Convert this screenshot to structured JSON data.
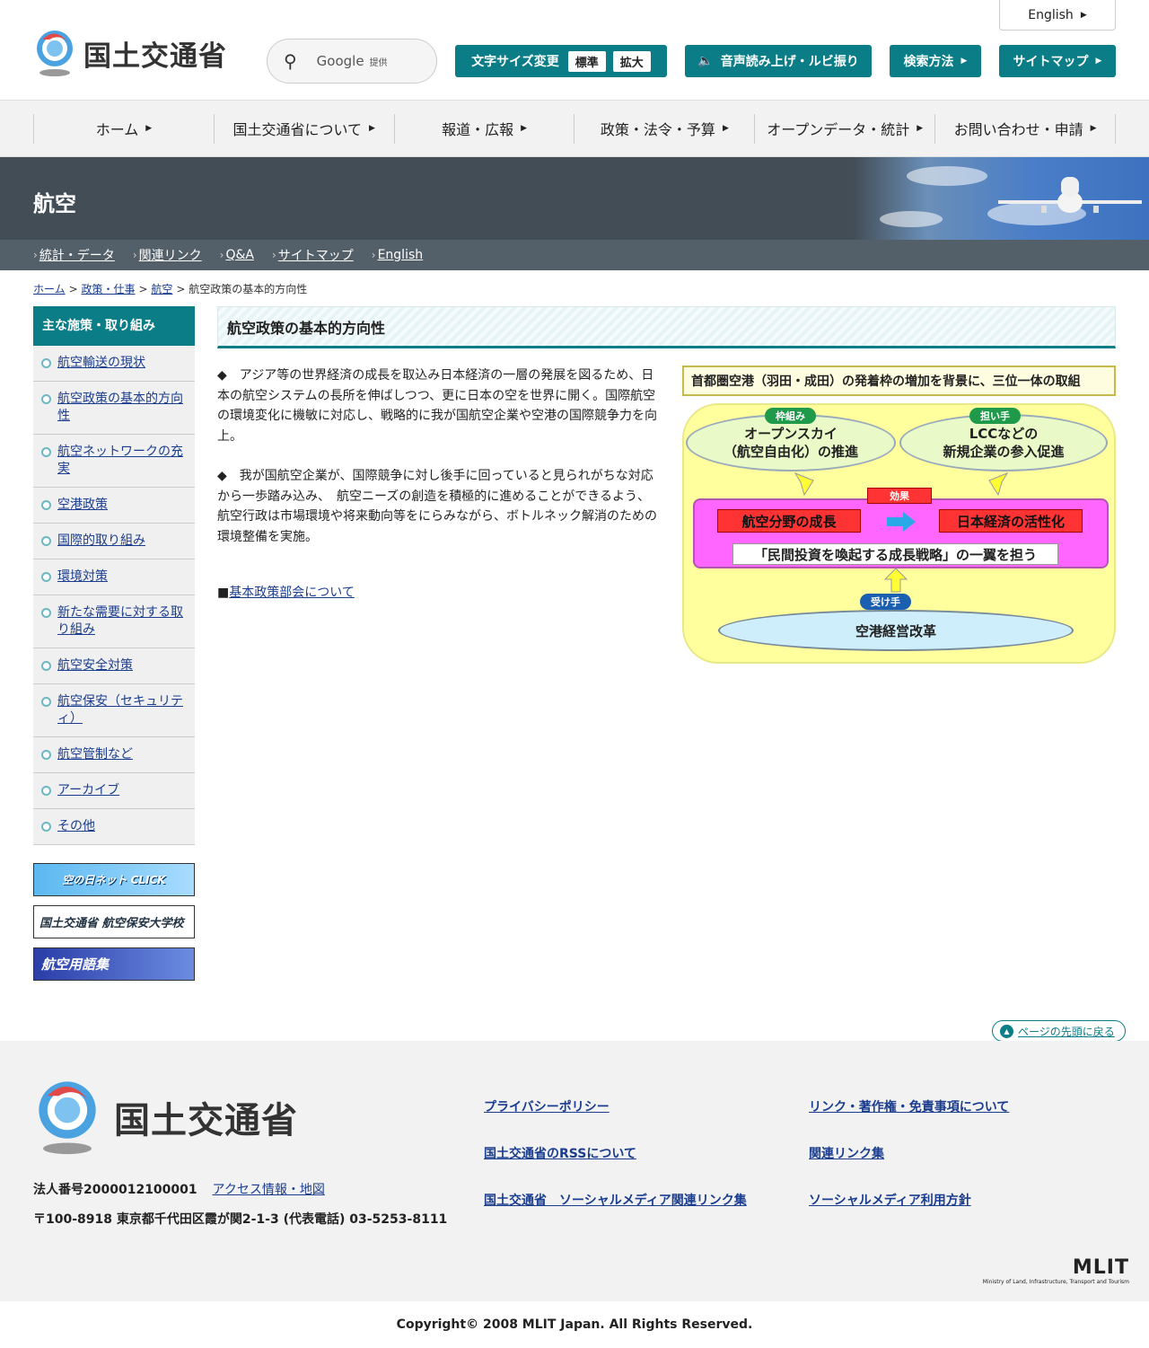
{
  "header": {
    "logo_text": "国土交通省",
    "search_label": "Google",
    "search_sub": "提供",
    "font_size_label": "文字サイズ変更",
    "font_standard": "標準",
    "font_large": "拡大",
    "voice_label": "音声読み上げ・ルビ振り",
    "search_method": "検索方法",
    "sitemap": "サイトマップ",
    "english": "English"
  },
  "nav": [
    "ホーム",
    "国土交通省について",
    "報道・広報",
    "政策・法令・予算",
    "オープンデータ・統計",
    "お問い合わせ・申請"
  ],
  "banner": {
    "title": "航空",
    "subnav": [
      "統計・データ",
      "関連リンク",
      "Q&A",
      "サイトマップ",
      "English"
    ]
  },
  "breadcrumb": {
    "items": [
      "ホーム",
      "政策・仕事",
      "航空"
    ],
    "current": "航空政策の基本的方向性"
  },
  "sidebar": {
    "heading": "主な施策・取り組み",
    "items": [
      "航空輸送の現状",
      "航空政策の基本的方向性",
      "航空ネットワークの充実",
      "空港政策",
      "国際的取り組み",
      "環境対策",
      "新たな需要に対する取り組み",
      "航空安全対策",
      "航空保安（セキュリティ）",
      "航空管制など",
      "アーカイブ",
      "その他"
    ],
    "banners": [
      "空の日ネット CLICK",
      "国土交通省 航空保安大学校",
      "航空用語集"
    ]
  },
  "main": {
    "title": "航空政策の基本的方向性",
    "para1": "◆　アジア等の世界経済の成長を取込み日本経済の一層の発展を図るため、日本の航空システムの長所を伸ばしつつ、更に日本の空を世界に開く。国際航空の環境変化に機敏に対応し、戦略的に我が国航空企業や空港の国際競争力を向上。",
    "para2": "◆　我が国航空企業が、国際競争に対し後手に回っていると見られがちな対応から一歩踏み込み、　航空ニーズの創造を積極的に進めることができるよう、航空行政は市場環境や将来動向等をにらみながら、ボトルネック解消のための環境整備を実施。",
    "link_prefix": "■",
    "link": "基本政策部会について"
  },
  "diagram": {
    "heading": "首都圏空港（羽田・成田）の発着枠の増加を背景に、三位一体の取組",
    "left_tag": "枠組み",
    "left_line1": "オープンスカイ",
    "left_line2": "（航空自由化）の推進",
    "right_tag": "担い手",
    "right_line1": "LCCなどの",
    "right_line2": "新規企業の参入促進",
    "effect": "効果",
    "growth": "航空分野の成長",
    "economy": "日本経済の活性化",
    "strategy": "「民間投資を喚起する成長戦略」の一翼を担う",
    "bottom_tag": "受け手",
    "bottom": "空港経営改革"
  },
  "totop": "ページの先頭に戻る",
  "footer": {
    "logo_text": "国土交通省",
    "corp_number": "法人番号2000012100001",
    "access": "アクセス情報・地図",
    "address": "〒100-8918 東京都千代田区霞が関2-1-3 (代表電話) 03-5253-8111",
    "links": [
      "プライバシーポリシー",
      "リンク・著作権・免責事項について",
      "国土交通省のRSSについて",
      "関連リンク集",
      "国土交通省　ソーシャルメディア関連リンク集",
      "ソーシャルメディア利用方針"
    ],
    "mlit": "MLIT",
    "mlit_sub": "Ministry of Land, Infrastructure, Transport and Tourism",
    "copyright": "Copyright© 2008 MLIT Japan. All Rights Reserved."
  },
  "colors": {
    "teal": "#0a7d87",
    "banner": "#424d55",
    "link": "#1a3d8f"
  }
}
